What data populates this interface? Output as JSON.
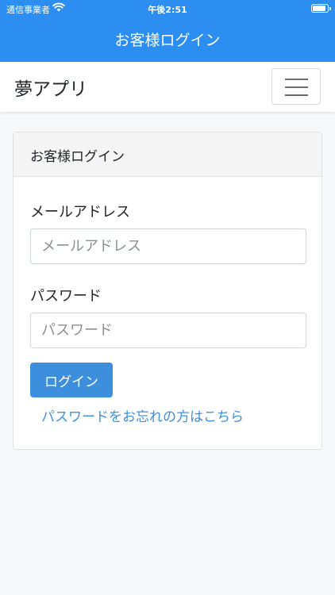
{
  "status_bar": {
    "carrier": "通信事業者",
    "time": "午後2:51"
  },
  "header": {
    "title": "お客様ログイン"
  },
  "navbar": {
    "brand": "夢アプリ"
  },
  "card": {
    "title": "お客様ログイン",
    "email": {
      "label": "メールアドレス",
      "value": "",
      "placeholder": "メールアドレス"
    },
    "password": {
      "label": "パスワード",
      "value": "",
      "placeholder": "パスワード"
    },
    "login_button": "ログイン",
    "forgot_link": "パスワードをお忘れの方はこちら"
  },
  "colors": {
    "header": "#2c8ef1",
    "button": "#3d8fde",
    "link": "#3d8fde"
  },
  "icons": [
    "wifi-icon",
    "battery-icon",
    "menu-icon"
  ]
}
